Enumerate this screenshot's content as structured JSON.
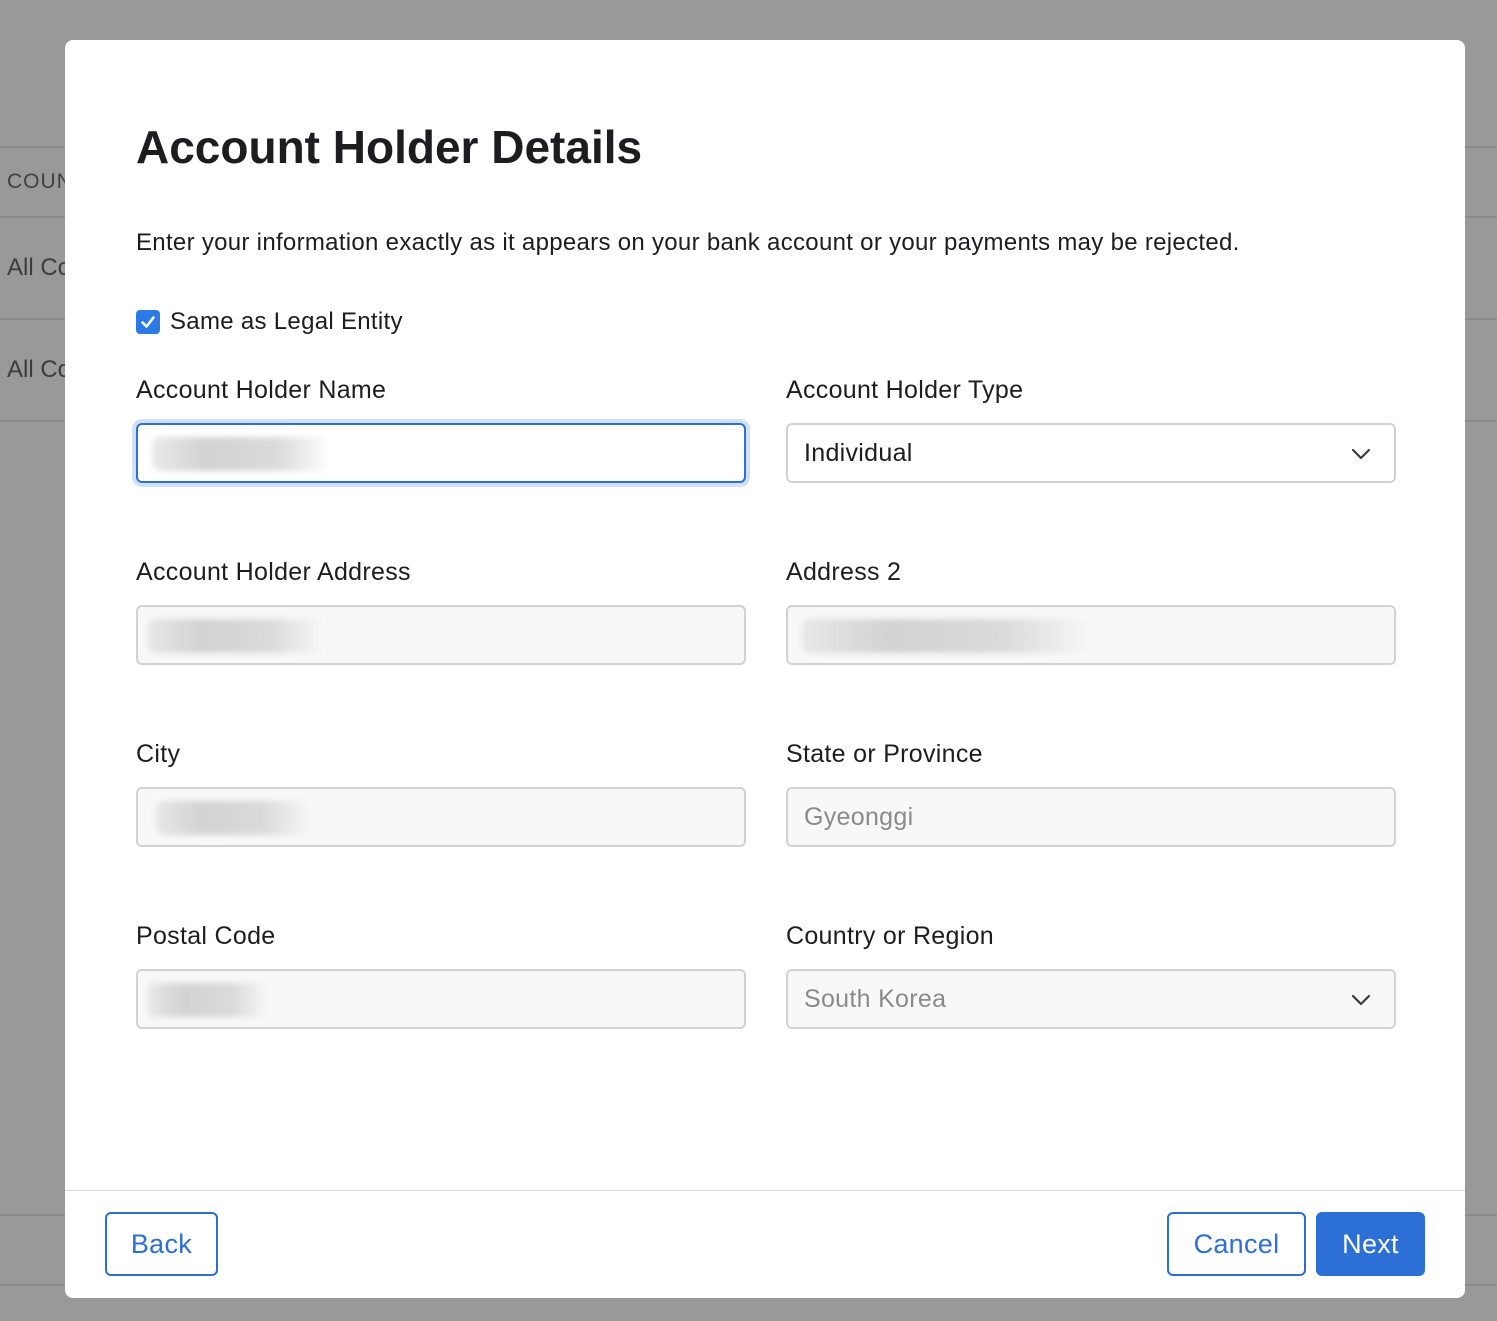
{
  "background": {
    "header_text": "COUN",
    "rows": [
      "All Co",
      "All Co"
    ]
  },
  "modal": {
    "title": "Account Holder Details",
    "description": "Enter your information exactly as it appears on your bank account or your payments may be rejected.",
    "same_as_legal_entity": {
      "label": "Same as Legal Entity",
      "checked": true
    },
    "fields": {
      "account_holder_name": {
        "label": "Account Holder Name",
        "value": ""
      },
      "account_holder_type": {
        "label": "Account Holder Type",
        "value": "Individual"
      },
      "account_holder_address": {
        "label": "Account Holder Address",
        "value": ""
      },
      "address_2": {
        "label": "Address 2",
        "value": ""
      },
      "city": {
        "label": "City",
        "value": ""
      },
      "state_or_province": {
        "label": "State or Province",
        "value": "Gyeonggi"
      },
      "postal_code": {
        "label": "Postal Code",
        "value": ""
      },
      "country_or_region": {
        "label": "Country or Region",
        "value": "South Korea"
      }
    },
    "buttons": {
      "back": "Back",
      "cancel": "Cancel",
      "next": "Next"
    }
  },
  "colors": {
    "accent": "#2c6fd6",
    "checkbox": "#2c7be5",
    "overlay": "#999999"
  }
}
